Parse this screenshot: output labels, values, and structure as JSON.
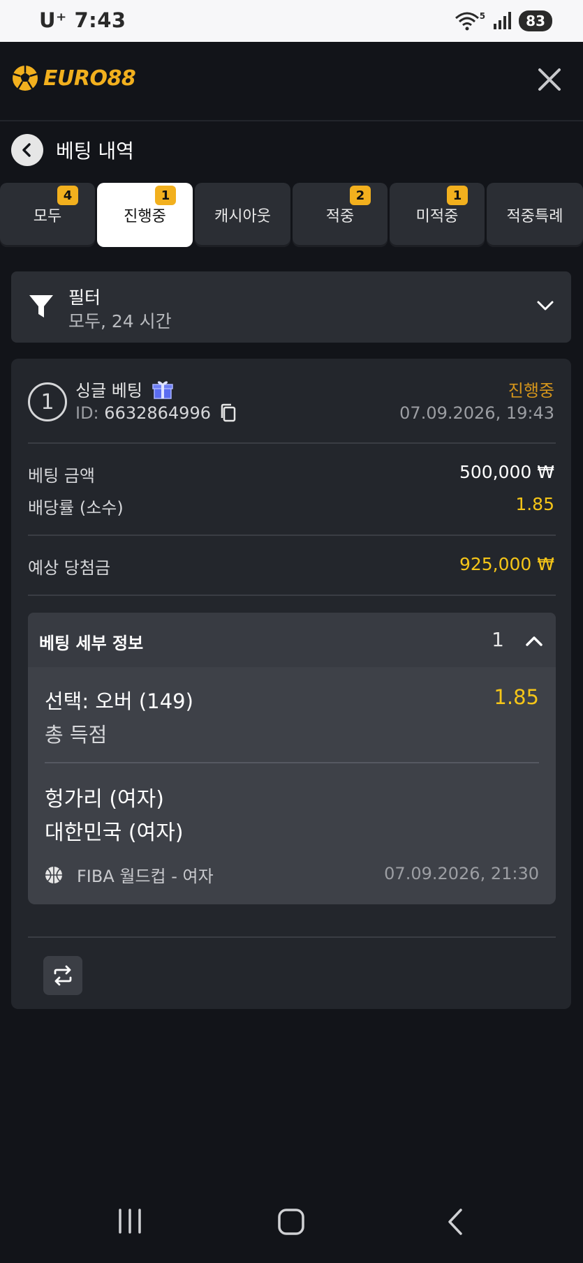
{
  "status_bar": {
    "carrier": "U⁺",
    "time": "7:43",
    "battery": "83",
    "network": "5"
  },
  "header": {
    "logo_text": "EURO88",
    "logo_icon": "soccer-ball-icon",
    "close_icon": "close-icon"
  },
  "page": {
    "title": "베팅 내역",
    "back_icon": "chevron-left-icon"
  },
  "tabs": [
    {
      "label": "모두",
      "badge": "4",
      "active": false
    },
    {
      "label": "진행중",
      "badge": "1",
      "active": true
    },
    {
      "label": "캐시아웃",
      "badge": "",
      "active": false
    },
    {
      "label": "적중",
      "badge": "2",
      "active": false
    },
    {
      "label": "미적중",
      "badge": "1",
      "active": false
    },
    {
      "label": "적중특례",
      "badge": "",
      "active": false
    }
  ],
  "filter": {
    "title": "필터",
    "value": "모두, 24 시간",
    "icon": "funnel-icon"
  },
  "bet": {
    "number": "1",
    "type": "싱글 베팅",
    "id_label": "ID:",
    "id_value": "6632864996",
    "status": "진행중",
    "placed_at": "07.09.2026, 19:43",
    "stake_label": "베팅 금액",
    "stake_value": "500,000 ₩",
    "odds_label": "배당률 (소수)",
    "odds_value": "1.85",
    "payout_label": "예상 당첨금",
    "payout_value": "925,000 ₩",
    "details": {
      "title": "베팅 세부 정보",
      "count": "1",
      "selection": "선택: 오버 (149)",
      "selection_odds": "1.85",
      "market": "총 득점",
      "team_home": "헝가리 (여자)",
      "team_away": "대한민국 (여자)",
      "league": "FIBA 월드컵 - 여자",
      "event_time": "07.09.2026, 21:30",
      "sport_icon": "basketball-icon"
    }
  },
  "colors": {
    "accent": "#f2b01e",
    "odds": "#f5c518",
    "background": "#121419",
    "card": "#23262c"
  }
}
